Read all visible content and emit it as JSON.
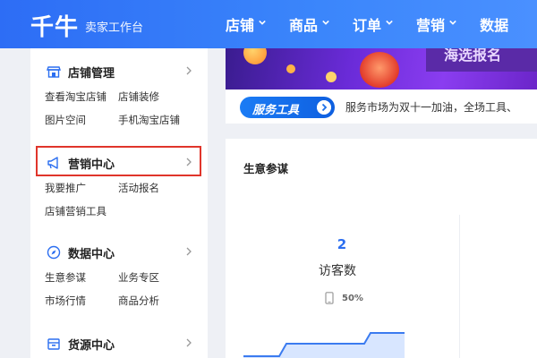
{
  "header": {
    "logo": "千牛",
    "subtitle": "卖家工作台",
    "nav": [
      {
        "label": "店铺",
        "has_menu": true
      },
      {
        "label": "商品",
        "has_menu": true
      },
      {
        "label": "订单",
        "has_menu": true
      },
      {
        "label": "营销",
        "has_menu": true
      },
      {
        "label": "数据",
        "has_menu": false
      }
    ]
  },
  "sidebar": {
    "sections": [
      {
        "title": "店铺管理",
        "icon": "shop-icon",
        "links": [
          "查看淘宝店铺",
          "店铺装修",
          "图片空间",
          "手机淘宝店铺"
        ]
      },
      {
        "title": "营销中心",
        "icon": "megaphone-icon",
        "links": [
          "我要推广",
          "活动报名",
          "店铺营销工具"
        ],
        "highlighted": true
      },
      {
        "title": "数据中心",
        "icon": "compass-icon",
        "links": [
          "生意参谋",
          "业务专区",
          "市场行情",
          "商品分析"
        ]
      },
      {
        "title": "货源中心",
        "icon": "box-icon",
        "links": []
      }
    ]
  },
  "banner": {
    "text": "海选报名"
  },
  "notice": {
    "badge": "服务工具",
    "text": "服务市场为双十一加油，全场工具、"
  },
  "card": {
    "title": "生意参谋",
    "metric": {
      "value": "2",
      "label": "访客数",
      "ratio": "50%"
    }
  },
  "colors": {
    "brand": "#2d6df5",
    "highlight": "#e0352b",
    "accent": "#2b6ef0"
  }
}
